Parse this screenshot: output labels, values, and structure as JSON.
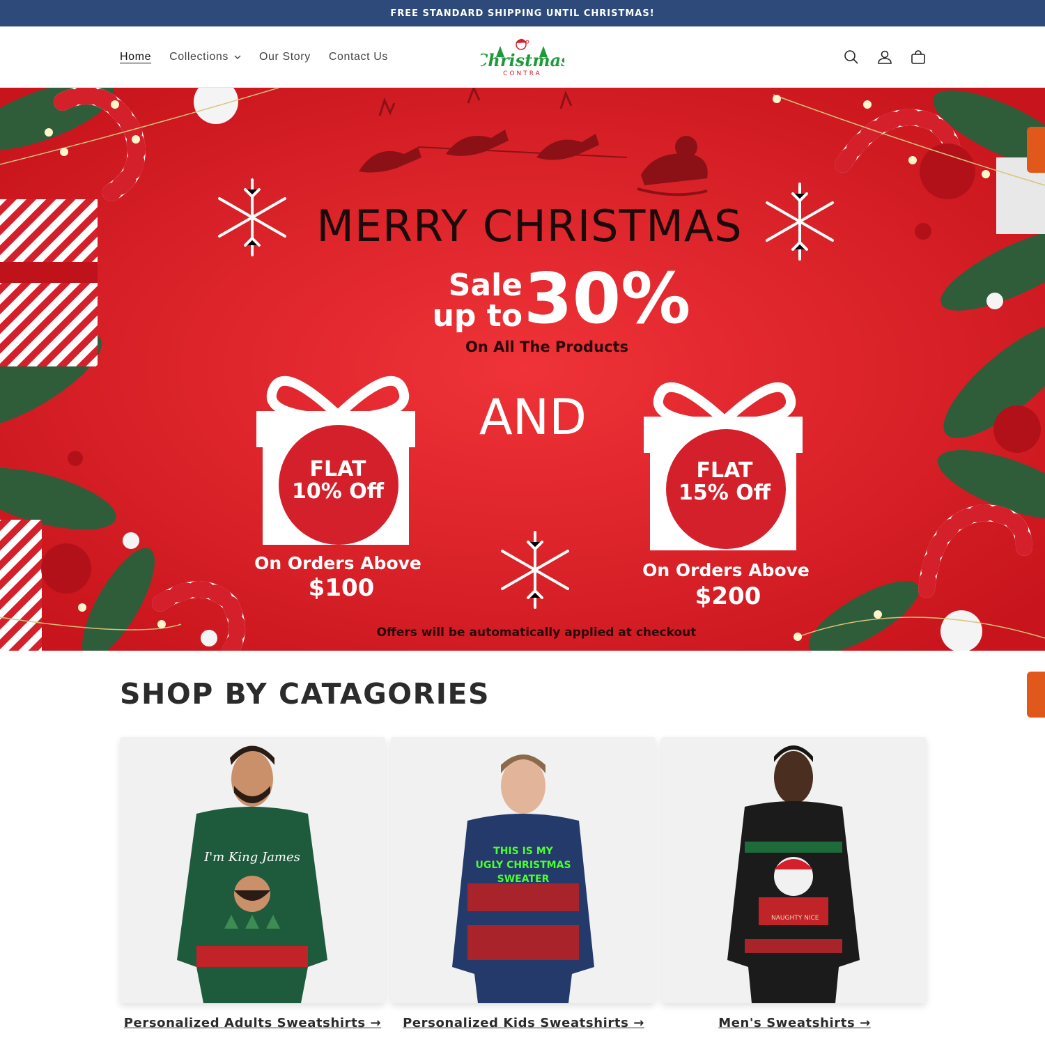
{
  "announcement": {
    "text": "FREE STANDARD SHIPPING UNTIL CHRISTMAS!"
  },
  "nav": {
    "home": "Home",
    "collections": "Collections",
    "our_story": "Our Story",
    "contact": "Contact Us"
  },
  "logo": {
    "name": "Christmas",
    "sub": "CONTRA"
  },
  "header_icons": [
    "search-icon",
    "account-icon",
    "cart-icon"
  ],
  "hero": {
    "title": "MERRY CHRISTMAS",
    "sale_line1": "Sale",
    "sale_line2": "up to",
    "sale_percent": "30%",
    "sale_sub": "On All The Products",
    "and": "AND",
    "offer1": {
      "flat": "FLAT",
      "off": "10% Off",
      "orders": "On Orders Above",
      "amount": "$100"
    },
    "offer2": {
      "flat": "FLAT",
      "off": "15% Off",
      "orders": "On Orders Above",
      "amount": "$200"
    },
    "footnote": "Offers will be automatically applied  at checkout"
  },
  "categories": {
    "title": "SHOP BY CATAGORIES",
    "items": [
      {
        "label": "Personalized Adults Sweatshirts →",
        "sweater_text": "I'm King James"
      },
      {
        "label": "Personalized Kids Sweatshirts →",
        "sweater_text": "THIS IS MY UGLY CHRISTMAS SWEATER"
      },
      {
        "label": "Men's Sweatshirts →",
        "sweater_text": "NAUGHTY NICE"
      }
    ]
  },
  "colors": {
    "announcement_bg": "#2e4a7a",
    "hero_red": "#e8262c",
    "accent_orange": "#e0581a",
    "logo_green": "#1e9a3a"
  }
}
